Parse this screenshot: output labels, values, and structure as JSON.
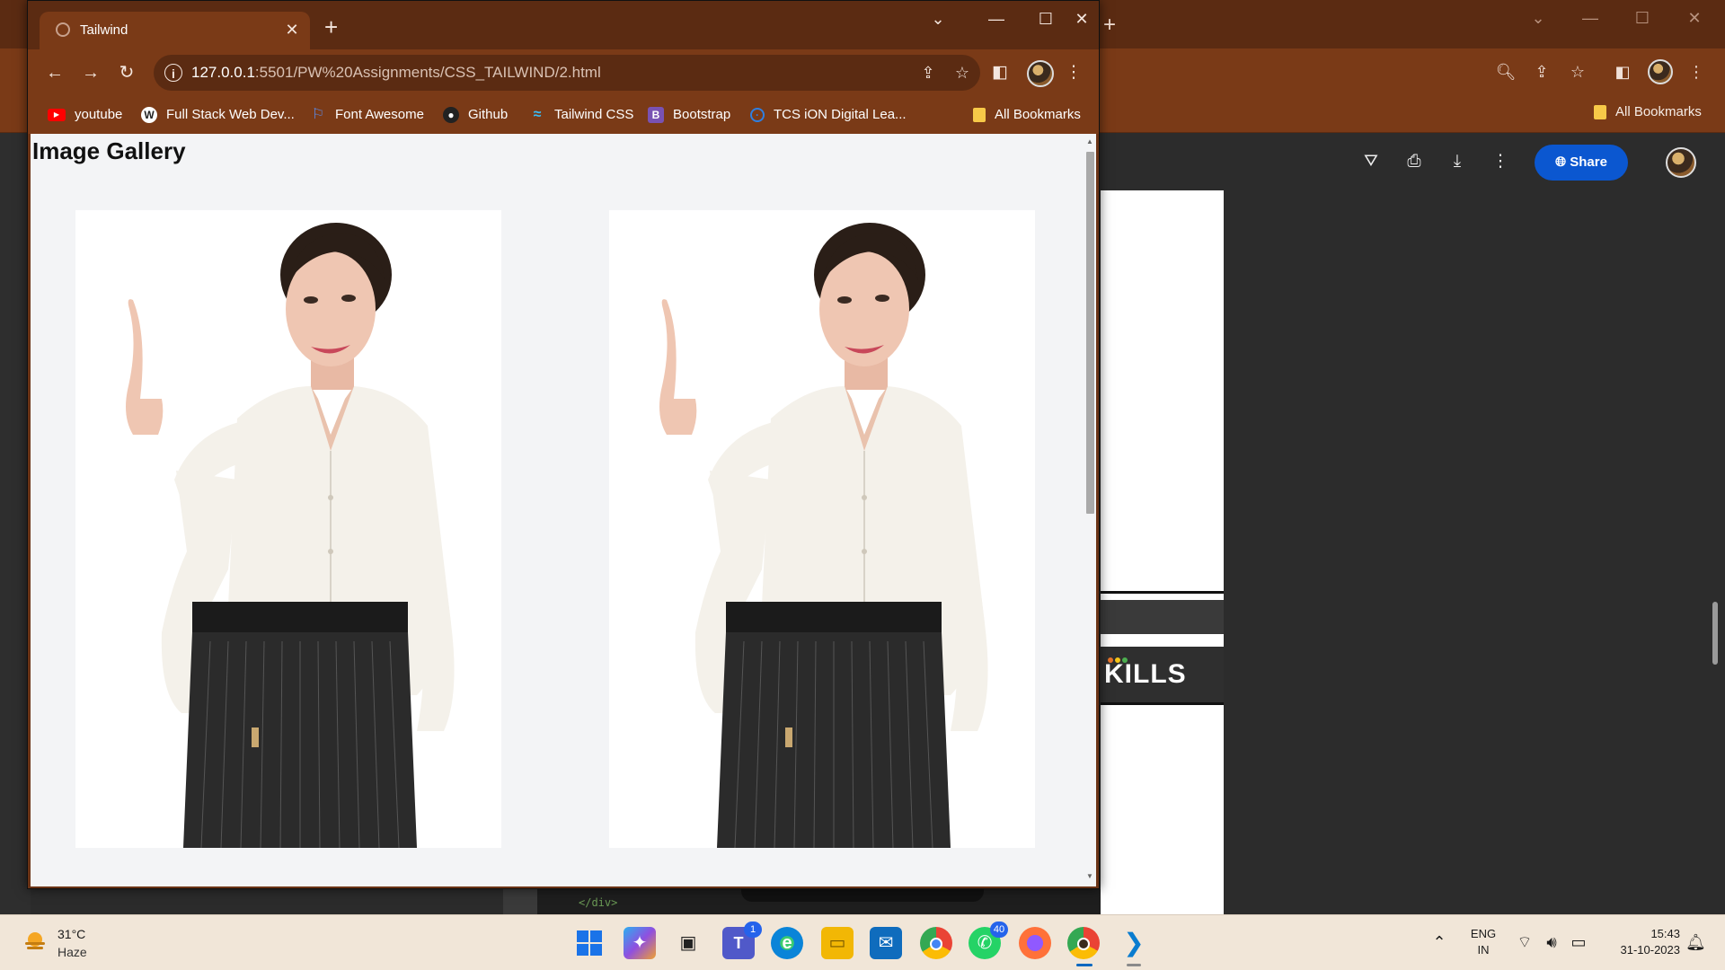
{
  "background_window": {
    "bookmark_all": "All Bookmarks",
    "docs_share_label": "Share",
    "docs_banner_text": "KILLS",
    "editor_code": "</div>"
  },
  "browser": {
    "tab_title": "Tailwind",
    "url_host": "127.0.0.1",
    "url_rest": ":5501/PW%20Assignments/CSS_TAILWIND/2.html",
    "bookmarks": [
      {
        "label": "youtube",
        "icon": "youtube-icon",
        "color": "#ff0000"
      },
      {
        "label": "Full Stack Web Dev...",
        "icon": "wordpress-icon",
        "color": "#ffffff"
      },
      {
        "label": "Font Awesome",
        "icon": "flag-icon",
        "color": "#5a8dee"
      },
      {
        "label": "Github",
        "icon": "github-icon",
        "color": "#222222"
      },
      {
        "label": "Tailwind CSS",
        "icon": "tailwind-icon",
        "color": "#38bdf8"
      },
      {
        "label": "Bootstrap",
        "icon": "bootstrap-icon",
        "color": "#7952b3"
      },
      {
        "label": "TCS iON Digital Lea...",
        "icon": "tcs-icon",
        "color": "#2f7fe0"
      }
    ],
    "all_bookmarks": "All Bookmarks"
  },
  "page": {
    "title": "Image Gallery",
    "images": [
      {
        "alt": "woman-pointing-up-photo"
      },
      {
        "alt": "woman-pointing-up-photo"
      }
    ]
  },
  "taskbar": {
    "weather_temp": "31°C",
    "weather_desc": "Haze",
    "teams_badge": "1",
    "whatsapp_badge": "40",
    "lang_top": "ENG",
    "lang_bottom": "IN",
    "time": "15:43",
    "date": "31-10-2023"
  },
  "colors": {
    "tab_strip": "#5b2b12",
    "toolbar": "#7a3a17",
    "page_bg": "#f3f4f6",
    "share_button": "#0b57d0"
  }
}
